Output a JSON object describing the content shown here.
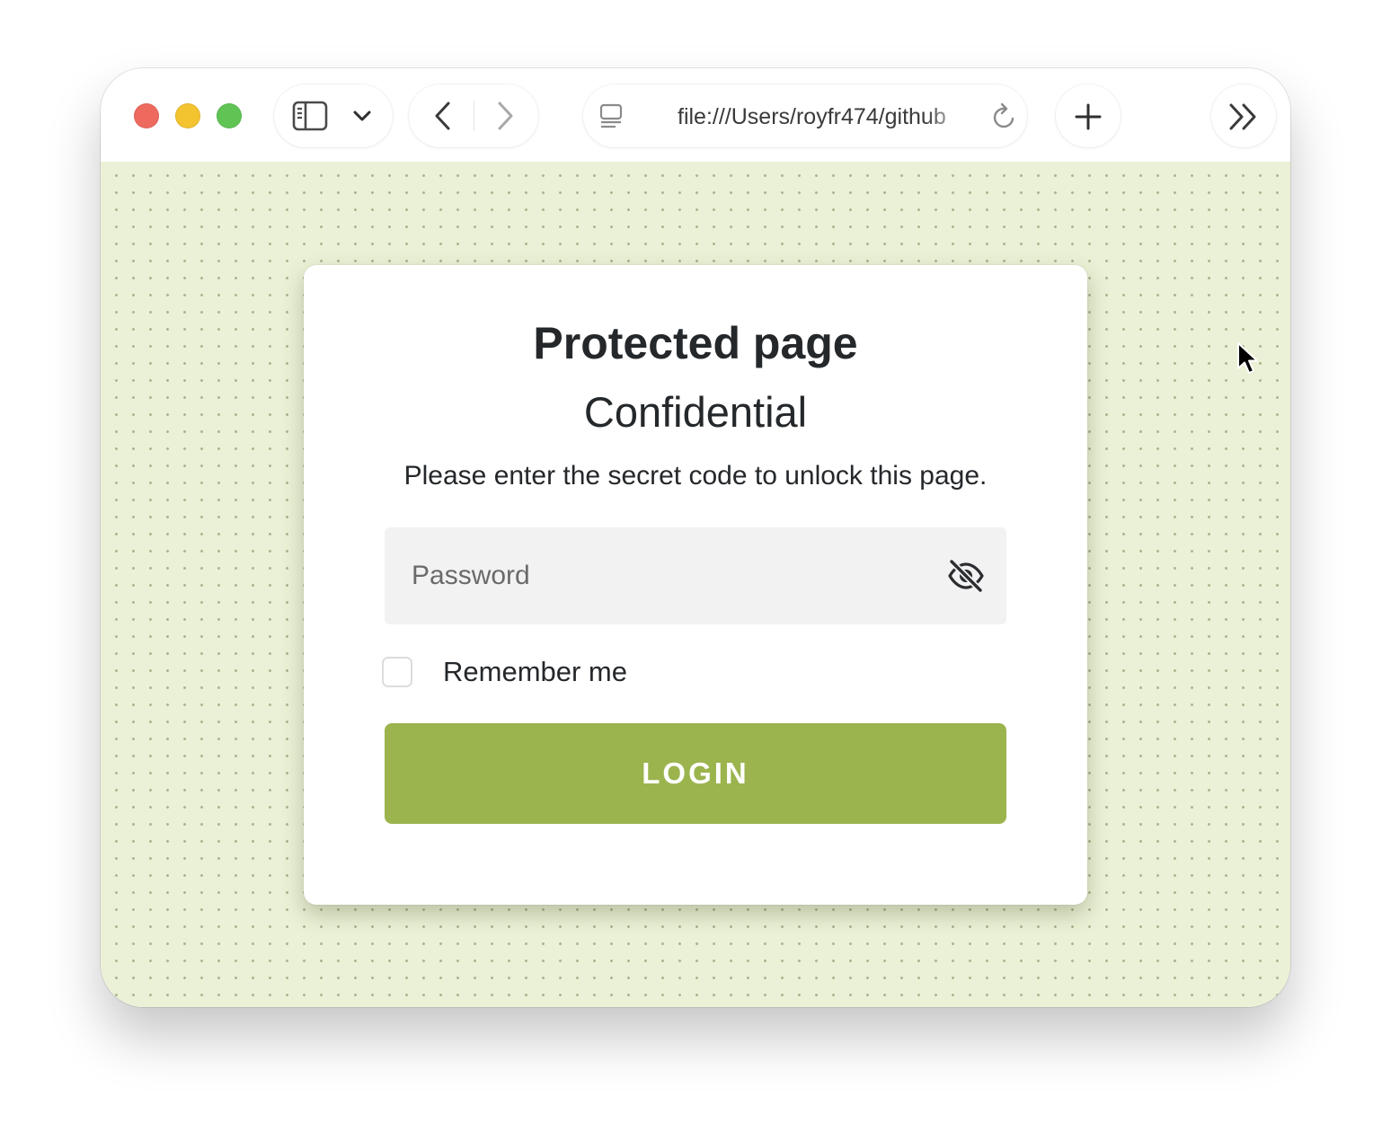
{
  "browser": {
    "url": "file:///Users/royfr474/github"
  },
  "card": {
    "title": "Protected page",
    "subtitle": "Confidential",
    "description": "Please enter the secret code to unlock this page.",
    "password_placeholder": "Password",
    "remember_label": "Remember me",
    "remember_checked": false,
    "login_label": "LOGIN"
  },
  "colors": {
    "page_background": "#eaf1d6",
    "accent_button": "#9bb44e",
    "traffic_red": "#ee6a5f",
    "traffic_yellow": "#f4c330",
    "traffic_green": "#5fc454"
  },
  "icons": {
    "sidebar": "sidebar-icon",
    "tab_overview": "chevron-down-icon",
    "back": "chevron-left-icon",
    "forward": "chevron-right-icon",
    "page_menu": "page-icon",
    "reload": "reload-icon",
    "new_tab": "plus-icon",
    "more": "double-chevron-right-icon",
    "password_visibility": "eye-slash-icon"
  }
}
